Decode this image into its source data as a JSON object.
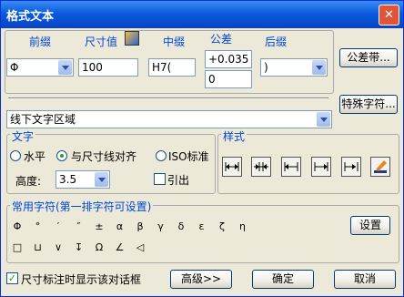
{
  "window": {
    "title": "格式文本",
    "close_glyph": "✕"
  },
  "columns": {
    "prefix": "前缀",
    "dimension_value": "尺寸值",
    "middle": "中缀",
    "tolerance": "公差",
    "suffix": "后缀"
  },
  "fields": {
    "prefix_value": "Φ",
    "dimension_value": "100",
    "middle_value": "H7(",
    "tolerance_upper": "+0.035",
    "tolerance_lower": "0",
    "suffix_value": ")"
  },
  "buttons": {
    "tolerance_band": "公差带...",
    "special_chars": "特殊字符...",
    "settings": "设置",
    "advanced": "高级>>",
    "ok": "确定",
    "cancel": "取消"
  },
  "below_text_area": {
    "selected": "线下文字区域"
  },
  "text_group": {
    "title": "文字",
    "radio_horizontal": "水平",
    "radio_align": "与尺寸线对齐",
    "radio_iso": "ISO标准",
    "selected_radio": "与尺寸线对齐",
    "height_label": "高度:",
    "height_value": "3.5",
    "leader_label": "引出",
    "leader_checked": false
  },
  "style_group": {
    "title": "样式"
  },
  "common_symbols": {
    "title": "常用字符(第一排字符可设置)",
    "row1": [
      "Φ",
      "°",
      "′",
      "″",
      "±",
      "α",
      "β",
      "γ",
      "δ",
      "ε",
      "ζ",
      "η"
    ],
    "row2": [
      "□",
      "⊔",
      "∨",
      "↧",
      "Ω",
      "∠",
      "◁"
    ]
  },
  "footer": {
    "show_dialog_label": "尺寸标注时显示该对话框",
    "show_dialog_checked": true
  },
  "colors": {
    "title_bar": "#0a5bdc",
    "group_title": "#0046d5",
    "dialog_bg": "#ece9d8"
  }
}
